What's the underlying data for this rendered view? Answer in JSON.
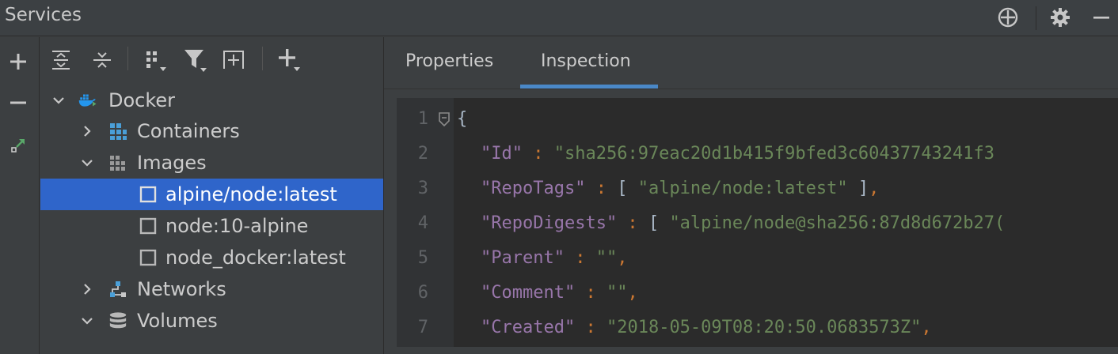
{
  "window": {
    "title": "Services"
  },
  "titlebar_icons": [
    "crosshair-icon",
    "gear-icon",
    "minimize-icon"
  ],
  "left_toolbar": [
    "add-icon",
    "remove-icon",
    "jump-to-source-icon"
  ],
  "tree_toolbar": [
    "expand-all-icon",
    "collapse-all-icon",
    "group-by-icon",
    "filter-icon",
    "new-service-icon",
    "add-service-icon"
  ],
  "tree": {
    "root": {
      "label": "Docker",
      "icon": "docker-icon",
      "expanded": true
    },
    "items": [
      {
        "label": "Containers",
        "icon": "containers-icon",
        "expanded": false
      },
      {
        "label": "Images",
        "icon": "images-icon",
        "expanded": true
      },
      {
        "label": "alpine/node:latest",
        "icon": "image-icon",
        "selected": true
      },
      {
        "label": "node:10-alpine",
        "icon": "image-icon"
      },
      {
        "label": "node_docker:latest",
        "icon": "image-icon"
      },
      {
        "label": "Networks",
        "icon": "networks-icon",
        "expanded": false
      },
      {
        "label": "Volumes",
        "icon": "volumes-icon",
        "expanded": true
      }
    ]
  },
  "tabs": [
    {
      "label": "Properties",
      "active": false
    },
    {
      "label": "Inspection",
      "active": true
    }
  ],
  "editor": {
    "lines": [
      {
        "n": "1",
        "brace": "{"
      },
      {
        "n": "2",
        "key": "\"Id\"",
        "sep": " : ",
        "value": "\"sha256:97eac20d1b415f9bfed3c60437743241f3"
      },
      {
        "n": "3",
        "key": "\"RepoTags\"",
        "sep": " : ",
        "open": "[ ",
        "value": "\"alpine/node:latest\"",
        "close": " ]",
        "comma": ","
      },
      {
        "n": "4",
        "key": "\"RepoDigests\"",
        "sep": " : ",
        "open": "[ ",
        "value": "\"alpine/node@sha256:87d8d672b27("
      },
      {
        "n": "5",
        "key": "\"Parent\"",
        "sep": " : ",
        "value": "\"\"",
        "comma": ","
      },
      {
        "n": "6",
        "key": "\"Comment\"",
        "sep": " : ",
        "value": "\"\"",
        "comma": ","
      },
      {
        "n": "7",
        "key": "\"Created\"",
        "sep": " : ",
        "value": "\"2018-05-09T08:20:50.0683573Z\"",
        "comma": ","
      }
    ]
  },
  "colors": {
    "selection": "#2f65ca",
    "tab_underline": "#4a88c7",
    "json_key": "#9876aa",
    "json_string": "#6a8759",
    "json_punct": "#cc7832",
    "docker_blue": "#2496ed"
  }
}
